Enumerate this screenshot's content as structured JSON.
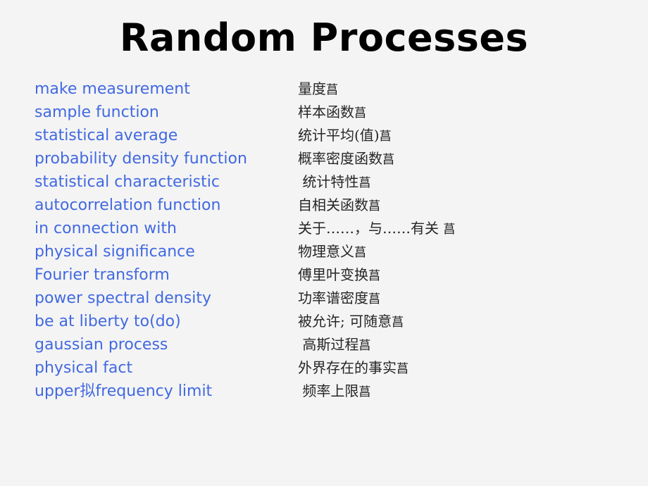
{
  "slide": {
    "title": "Random Processes",
    "background_color": "#f4f4f4",
    "title_color": "#000000",
    "english_color": "#4169e1",
    "chinese_color": "#262626"
  },
  "vocabulary": [
    {
      "english": "make measurement",
      "chinese": "量度",
      "tail": "菖"
    },
    {
      "english": "sample function",
      "chinese": "样本函数",
      "tail": "菖"
    },
    {
      "english": "statistical average",
      "chinese": "统计平均(值)",
      "tail": "菖"
    },
    {
      "english": "probability density function",
      "chinese": "概率密度函数",
      "tail": "菖"
    },
    {
      "english": "statistical characteristic",
      "chinese": " 统计特性",
      "tail": "菖"
    },
    {
      "english": "autocorrelation function",
      "chinese": "自相关函数",
      "tail": "菖"
    },
    {
      "english": "in connection with",
      "chinese": "关于……，与……有关 ",
      "tail": "菖"
    },
    {
      "english": "physical significance",
      "chinese": "物理意义",
      "tail": "菖"
    },
    {
      "english": "Fourier transform",
      "chinese": "傅里叶变换",
      "tail": "菖"
    },
    {
      "english": "power spectral density",
      "chinese": "功率谱密度",
      "tail": "菖"
    },
    {
      "english": "be at liberty to(do)",
      "chinese": "被允许; 可随意",
      "tail": "菖"
    },
    {
      "english": "gaussian process",
      "chinese": " 高斯过程",
      "tail": "菖"
    },
    {
      "english": "physical fact",
      "chinese": "外界存在的事实",
      "tail": "菖"
    },
    {
      "english": "upper拟frequency limit",
      "chinese": " 频率上限",
      "tail": "菖"
    }
  ]
}
